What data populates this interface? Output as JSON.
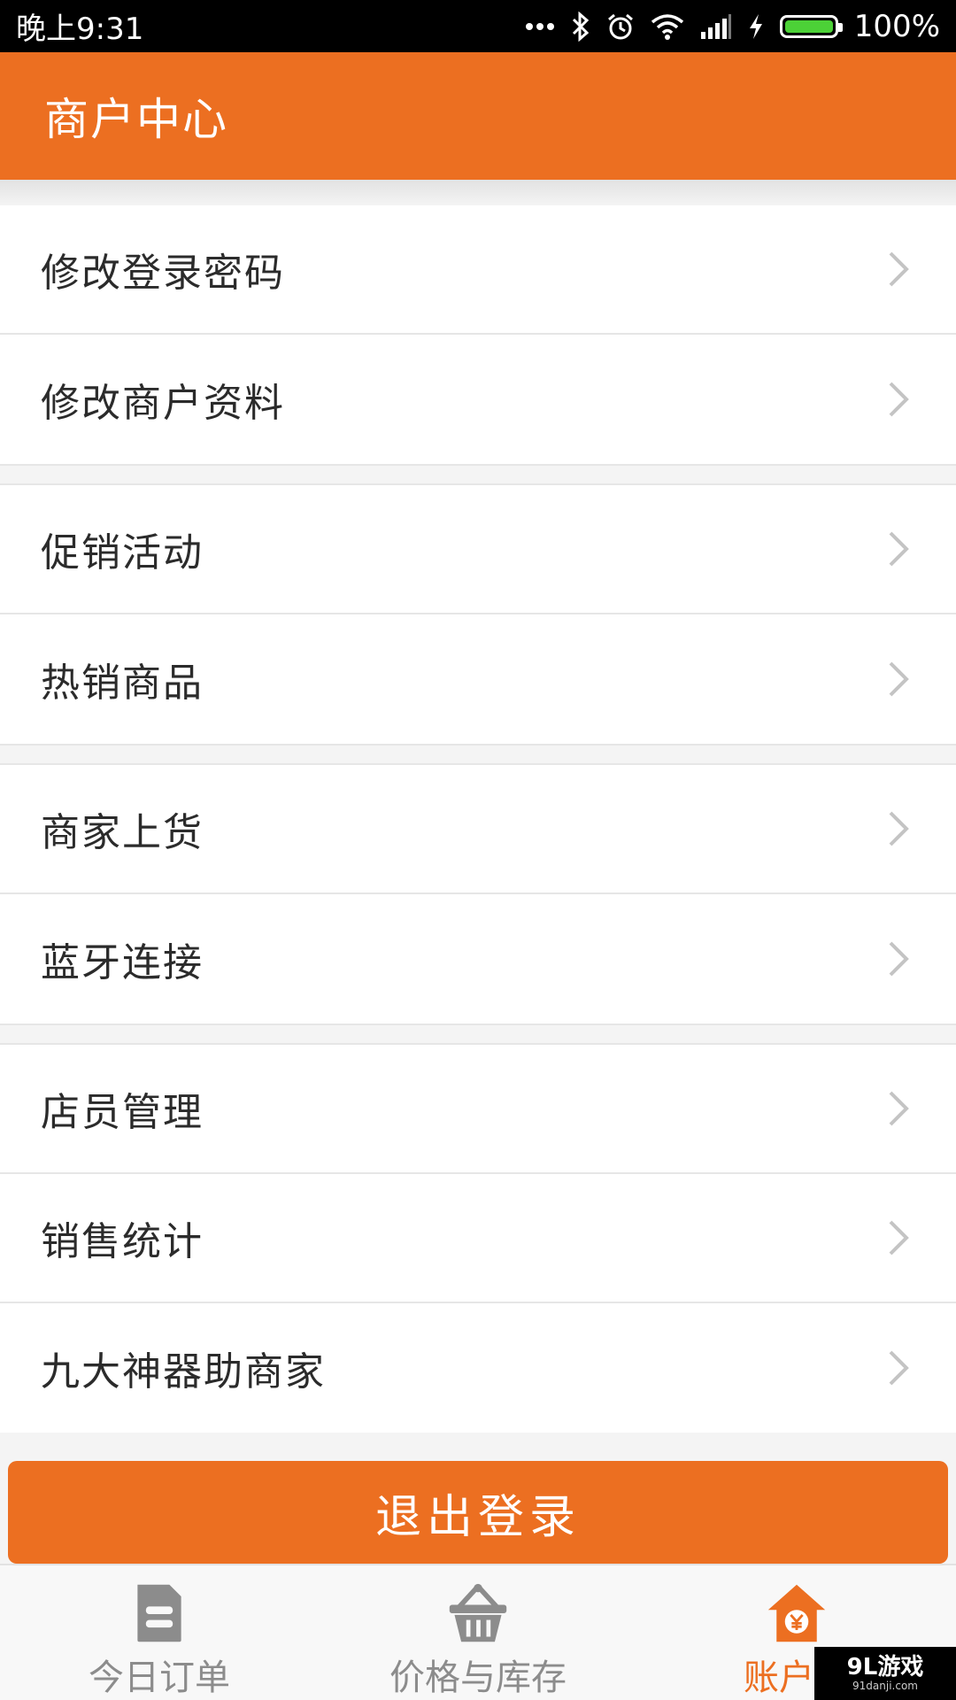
{
  "status_bar": {
    "time": "晚上9:31",
    "battery": "100%",
    "icons": [
      "more-dots-icon",
      "bluetooth-icon",
      "alarm-icon",
      "wifi-icon",
      "signal-icon",
      "charging-icon",
      "battery-icon"
    ]
  },
  "header": {
    "title": "商户中心"
  },
  "menu_groups": [
    {
      "items": [
        {
          "label": "修改登录密码"
        },
        {
          "label": "修改商户资料"
        }
      ]
    },
    {
      "items": [
        {
          "label": "促销活动"
        },
        {
          "label": "热销商品"
        }
      ]
    },
    {
      "items": [
        {
          "label": "商家上货"
        },
        {
          "label": "蓝牙连接"
        }
      ]
    },
    {
      "items": [
        {
          "label": "店员管理"
        },
        {
          "label": "销售统计"
        },
        {
          "label": "九大神器助商家"
        }
      ]
    }
  ],
  "logout_button": {
    "label": "退出登录"
  },
  "bottom_nav": {
    "tabs": [
      {
        "label": "今日订单",
        "icon": "document-icon",
        "active": false
      },
      {
        "label": "价格与库存",
        "icon": "basket-icon",
        "active": false
      },
      {
        "label": "账户中",
        "icon": "home-yen-icon",
        "active": true
      }
    ]
  },
  "watermark": {
    "brand": "9L游戏",
    "domain": "91danji.com"
  },
  "colors": {
    "accent": "#ec6f21",
    "status_bar": "#000000",
    "text": "#2b2b2b",
    "inactive": "#8c8c8c",
    "battery": "#4cd137"
  }
}
